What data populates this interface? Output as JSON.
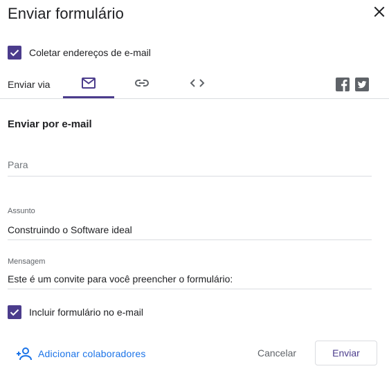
{
  "dialog": {
    "title": "Enviar formulário"
  },
  "collect_emails": {
    "label": "Coletar endereços de e-mail",
    "checked": true
  },
  "send_via": {
    "label": "Enviar via",
    "tabs": [
      {
        "icon": "email-icon",
        "active": true
      },
      {
        "icon": "link-icon",
        "active": false
      },
      {
        "icon": "embed-code-icon",
        "active": false
      }
    ],
    "social": [
      {
        "icon": "facebook-icon"
      },
      {
        "icon": "twitter-icon"
      }
    ]
  },
  "email_section": {
    "title": "Enviar por e-mail",
    "to": {
      "placeholder": "Para",
      "value": ""
    },
    "subject": {
      "label": "Assunto",
      "value": "Construindo o Software ideal"
    },
    "message": {
      "label": "Mensagem",
      "value": "Este é um convite para você preencher o formulário:"
    },
    "include_form": {
      "label": "Incluir formulário no e-mail",
      "checked": true
    }
  },
  "footer": {
    "add_collaborators": "Adicionar colaboradores",
    "cancel": "Cancelar",
    "send": "Enviar"
  },
  "colors": {
    "accent": "#4b3c8c",
    "link": "#1a73e8",
    "text": "#202124",
    "muted": "#5f6368",
    "divider": "#dadce0"
  }
}
